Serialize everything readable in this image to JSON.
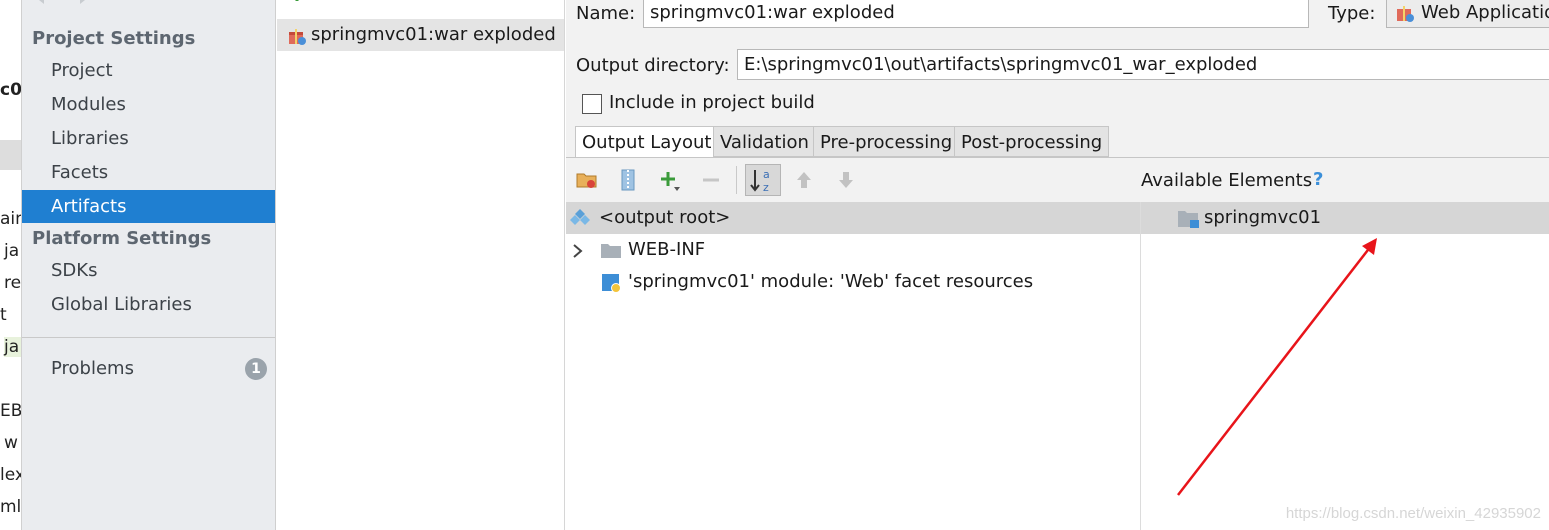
{
  "left_fragments": [
    "c0",
    "ain",
    "ja",
    "re",
    "t",
    "ja",
    "EB-",
    "w",
    "lex",
    "ml"
  ],
  "nav": {
    "project_settings": "Project Settings",
    "project_items": [
      "Project",
      "Modules",
      "Libraries",
      "Facets",
      "Artifacts"
    ],
    "platform_settings": "Platform Settings",
    "platform_items": [
      "SDKs",
      "Global Libraries"
    ],
    "problems": "Problems",
    "problems_count": "1",
    "selected": "Artifacts"
  },
  "artifacts": {
    "item": "springmvc01:war exploded"
  },
  "details": {
    "name_label": "Name:",
    "name_value": "springmvc01:war exploded",
    "type_label": "Type:",
    "type_value": "Web Applicatio",
    "output_label": "Output directory:",
    "output_value": "E:\\springmvc01\\out\\artifacts\\springmvc01_war_exploded",
    "include_label": "Include in project build",
    "include_checked": false,
    "tabs": [
      "Output Layout",
      "Validation",
      "Pre-processing",
      "Post-processing"
    ],
    "active_tab": "Output Layout",
    "available_label": "Available Elements",
    "help_mark": "?",
    "tree": {
      "root": "<output root>",
      "webinf": "WEB-INF",
      "facet": "'springmvc01' module: 'Web' facet resources"
    },
    "available": [
      "springmvc01"
    ]
  },
  "watermark": "https://blog.csdn.net/weixin_42935902",
  "colors": {
    "selection": "#1f7fd1",
    "arrow": "#e8141a",
    "add": "#3a9b3a"
  }
}
